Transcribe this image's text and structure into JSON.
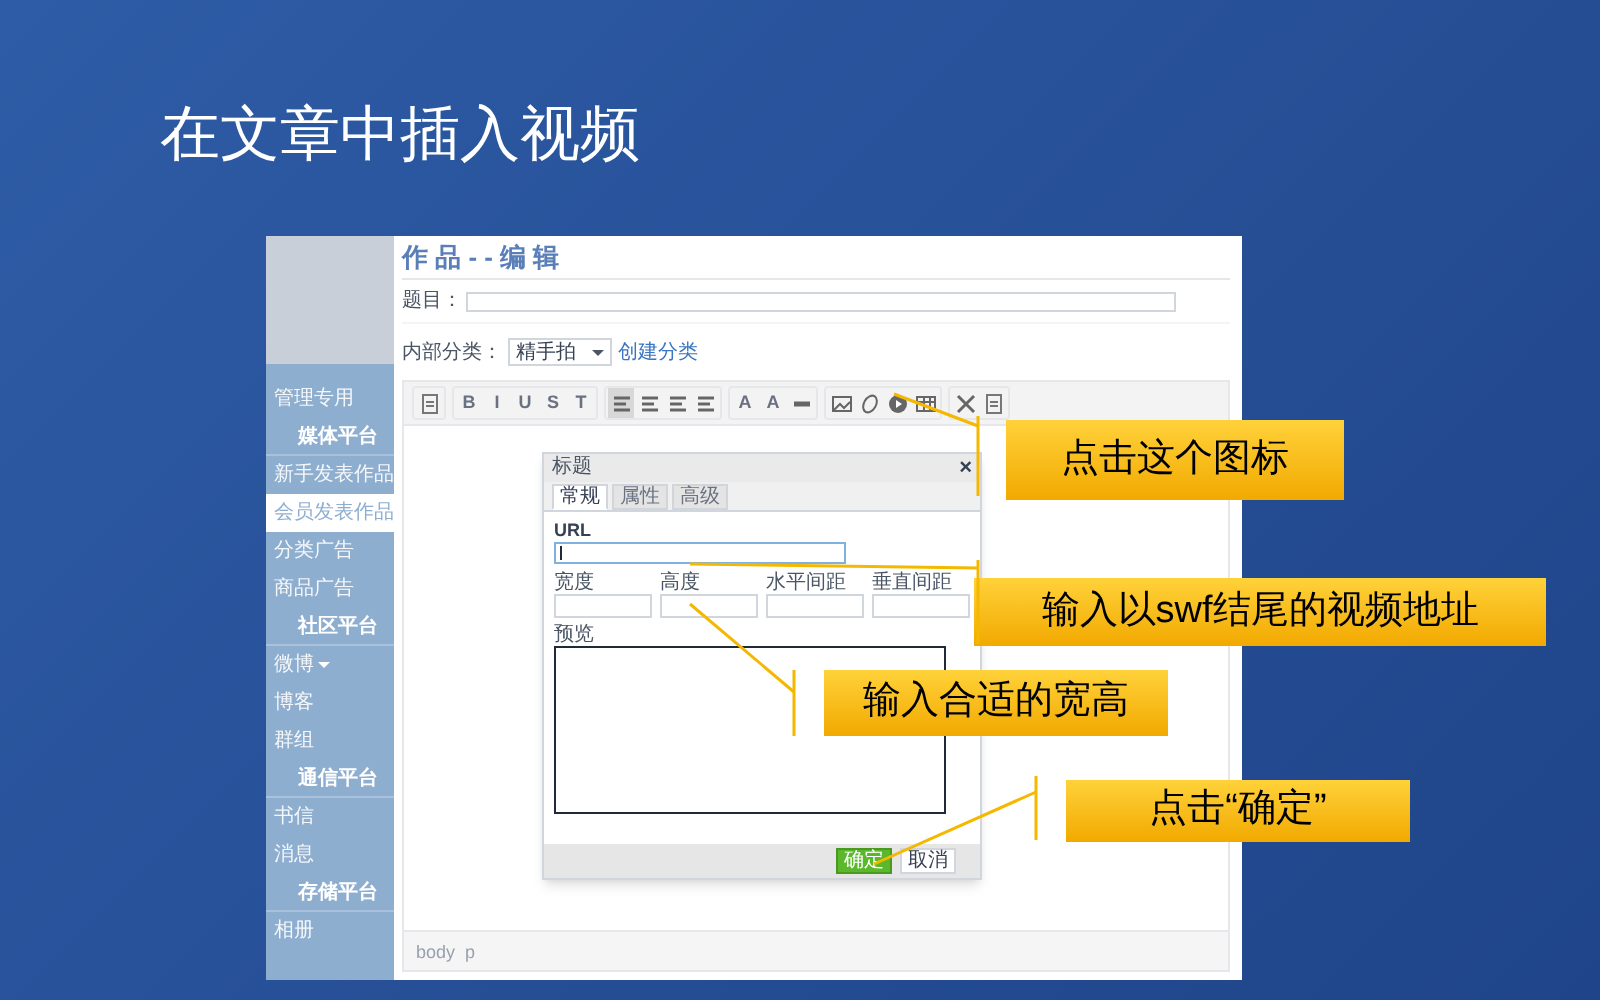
{
  "slide_title": "在文章中插入视频",
  "sidebar": {
    "items": [
      {
        "kind": "item",
        "label": "管理专用",
        "selected": false,
        "dropdown": false
      },
      {
        "kind": "heading",
        "label": "媒体平台"
      },
      {
        "kind": "item",
        "label": "新手发表作品",
        "selected": false,
        "dropdown": false
      },
      {
        "kind": "item",
        "label": "会员发表作品",
        "selected": true,
        "dropdown": false
      },
      {
        "kind": "item",
        "label": "分类广告",
        "selected": false,
        "dropdown": false
      },
      {
        "kind": "item",
        "label": "商品广告",
        "selected": false,
        "dropdown": false
      },
      {
        "kind": "heading",
        "label": "社区平台"
      },
      {
        "kind": "item",
        "label": "微博",
        "selected": false,
        "dropdown": true
      },
      {
        "kind": "item",
        "label": "博客",
        "selected": false,
        "dropdown": false
      },
      {
        "kind": "item",
        "label": "群组",
        "selected": false,
        "dropdown": false
      },
      {
        "kind": "heading",
        "label": "通信平台"
      },
      {
        "kind": "item",
        "label": "书信",
        "selected": false,
        "dropdown": false
      },
      {
        "kind": "item",
        "label": "消息",
        "selected": false,
        "dropdown": false
      },
      {
        "kind": "heading",
        "label": "存储平台"
      },
      {
        "kind": "item",
        "label": "相册",
        "selected": false,
        "dropdown": false
      }
    ]
  },
  "page_heading": "作 品 - - 编 辑",
  "title_field": {
    "label": "题目："
  },
  "category": {
    "label": "内部分类：",
    "value": "精手拍",
    "link": "创建分类"
  },
  "toolbar": [
    [
      {
        "kind": "doc"
      }
    ],
    [
      {
        "kind": "text",
        "label": "B"
      },
      {
        "kind": "text",
        "label": "I"
      },
      {
        "kind": "text",
        "label": "U"
      },
      {
        "kind": "text",
        "label": "S"
      },
      {
        "kind": "text",
        "label": "T"
      }
    ],
    [
      {
        "kind": "align",
        "selected": true
      },
      {
        "kind": "align",
        "selected": false
      },
      {
        "kind": "align",
        "selected": false
      },
      {
        "kind": "align",
        "selected": false
      }
    ],
    [
      {
        "kind": "text",
        "label": "A"
      },
      {
        "kind": "text",
        "label": "A"
      },
      {
        "kind": "rule"
      }
    ],
    [
      {
        "kind": "image"
      },
      {
        "kind": "clip"
      },
      {
        "kind": "video"
      },
      {
        "kind": "table"
      }
    ],
    [
      {
        "kind": "expand"
      },
      {
        "kind": "doc"
      }
    ]
  ],
  "status_path": "body  p",
  "dialog": {
    "title": "标题",
    "close": "×",
    "tabs": [
      {
        "label": "常规",
        "selected": true
      },
      {
        "label": "属性",
        "selected": false
      },
      {
        "label": "高级",
        "selected": false
      }
    ],
    "url_label": "URL",
    "size_fields": [
      "宽度",
      "高度",
      "水平间距",
      "垂直间距"
    ],
    "preview_label": "预览",
    "buttons": [
      {
        "label": "确定",
        "primary": true
      },
      {
        "label": "取消",
        "primary": false
      }
    ]
  },
  "callouts": [
    "点击这个图标",
    "输入以swf结尾的视频地址",
    "输入合适的宽高",
    "点击“确定”"
  ]
}
